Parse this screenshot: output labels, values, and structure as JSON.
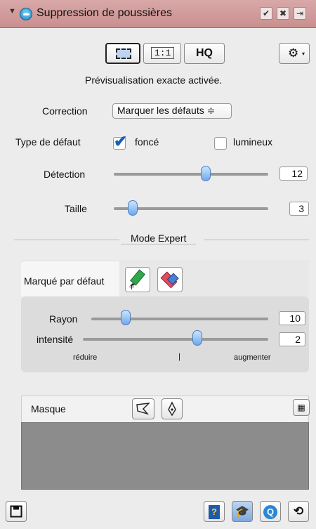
{
  "window": {
    "title": "Suppression de poussières",
    "buttons": [
      "✔",
      "✖",
      "⇥"
    ]
  },
  "preview": {
    "btn_fit": "",
    "btn_1to1": "1:1",
    "btn_hq": "HQ",
    "status": "Prévisualisation exacte activée."
  },
  "settings_button": "⚙",
  "correction": {
    "label": "Correction",
    "value": "Marquer les défauts ≑"
  },
  "defect_type": {
    "label": "Type de défaut",
    "options": [
      {
        "label": "foncé",
        "checked": true
      },
      {
        "label": "lumineux",
        "checked": false
      }
    ]
  },
  "detection": {
    "label": "Détection",
    "value": "12",
    "level": 0.6
  },
  "size": {
    "label": "Taille",
    "value": "3",
    "level": 0.05
  },
  "expert_mode": {
    "label": "Mode Expert"
  },
  "marked_default": {
    "label": "Marqué par défaut"
  },
  "radius": {
    "label": "Rayon",
    "value": "10",
    "level": 0.05
  },
  "intensity": {
    "label": "intensité",
    "value": "2",
    "level": 0.6
  },
  "scale": {
    "left": "réduire",
    "mid": "|",
    "right": "augmenter"
  },
  "mask": {
    "label": "Masque"
  },
  "colors": {
    "titlebar": "#d9a8a8",
    "slider_thumb": "#6fa8ea"
  }
}
